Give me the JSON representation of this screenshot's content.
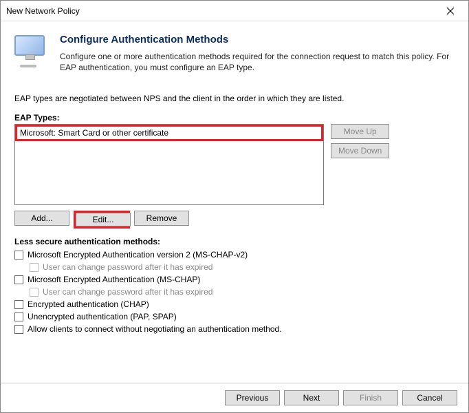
{
  "window": {
    "title": "New Network Policy"
  },
  "header": {
    "heading": "Configure Authentication Methods",
    "description": "Configure one or more authentication methods required for the connection request to match this policy. For EAP authentication, you must configure an EAP type."
  },
  "instruction": "EAP types are negotiated between NPS and the client in the order in which they are listed.",
  "eap": {
    "label": "EAP Types:",
    "items": [
      "Microsoft: Smart Card or other certificate"
    ],
    "move_up": "Move Up",
    "move_down": "Move Down",
    "add": "Add...",
    "edit": "Edit...",
    "remove": "Remove"
  },
  "less_secure": {
    "label": "Less secure authentication methods:",
    "options": {
      "mschap2": "Microsoft Encrypted Authentication version 2 (MS-CHAP-v2)",
      "mschap2_sub": "User can change password after it has expired",
      "mschap": "Microsoft Encrypted Authentication (MS-CHAP)",
      "mschap_sub": "User can change password after it has expired",
      "chap": "Encrypted authentication (CHAP)",
      "pap": "Unencrypted authentication (PAP, SPAP)",
      "no_auth": "Allow clients to connect without negotiating an authentication method."
    }
  },
  "footer": {
    "previous": "Previous",
    "next": "Next",
    "finish": "Finish",
    "cancel": "Cancel"
  }
}
